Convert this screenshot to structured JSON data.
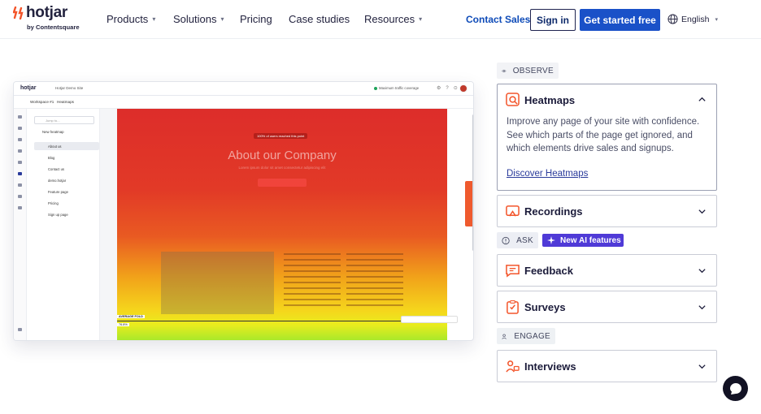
{
  "brand": {
    "name": "hotjar",
    "byline": "by Contentsquare",
    "accent": "#f3552b"
  },
  "nav": {
    "items": [
      {
        "label": "Products",
        "dropdown": true
      },
      {
        "label": "Solutions",
        "dropdown": true
      },
      {
        "label": "Pricing",
        "dropdown": false
      },
      {
        "label": "Case studies",
        "dropdown": false
      },
      {
        "label": "Resources",
        "dropdown": true
      }
    ],
    "contact_label": "Contact Sales",
    "signin_label": "Sign in",
    "cta_label": "Get started free",
    "language_label": "English",
    "primary_color": "#1a51c8"
  },
  "preview": {
    "app_logo": "hotjar",
    "site_selector": "Hotjar Demo Site",
    "traffic_label": "Maximum traffic coverage",
    "workspace": "Workspace #1",
    "breadcrumb": "Heatmaps",
    "search_placeholder": "Jump to...",
    "new_heatmap": "New heatmap",
    "pages": [
      "About us",
      "Blog",
      "Contact us",
      "demo.hotjar",
      "Feature page",
      "Pricing",
      "Sign up page"
    ],
    "selected_page": "About us",
    "reach_badge": "100% of users reached this point",
    "hero_title": "About our Company",
    "hero_subtitle": "Lorem ipsum dolor sit amet consectetur adipiscing elit",
    "fold_label": "AVERAGE FOLD",
    "fold_percent": "76.8%"
  },
  "categories": {
    "observe": "OBSERVE",
    "ask": "ASK",
    "engage": "ENGAGE",
    "ai_badge": "New AI features"
  },
  "accordion": {
    "heatmaps": {
      "title": "Heatmaps",
      "icon": "heatmap-icon",
      "expanded": true,
      "body": "Improve any page of your site with confidence. See which parts of the page get ignored, and which elements drive sales and signups.",
      "link": "Discover Heatmaps"
    },
    "recordings": {
      "title": "Recordings",
      "icon": "recording-icon",
      "expanded": false
    },
    "feedback": {
      "title": "Feedback",
      "icon": "feedback-icon",
      "expanded": false
    },
    "surveys": {
      "title": "Surveys",
      "icon": "survey-icon",
      "expanded": false
    },
    "interviews": {
      "title": "Interviews",
      "icon": "interview-icon",
      "expanded": false
    }
  }
}
